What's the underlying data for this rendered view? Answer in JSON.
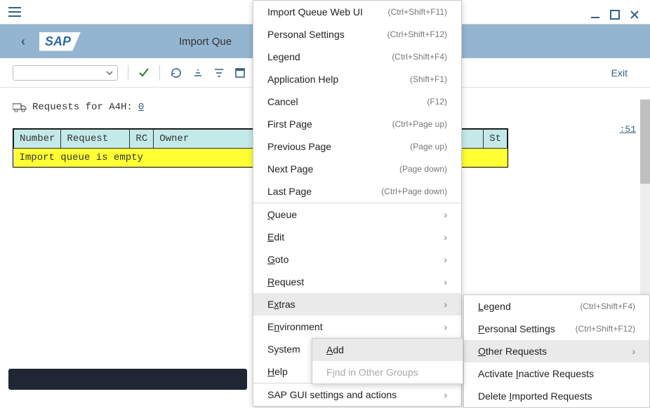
{
  "header": {
    "title": "Import Que",
    "logo_text": "SAP"
  },
  "toolbar": {
    "exit_label": "Exit"
  },
  "content": {
    "requests_label": "Requests for A4H:",
    "requests_count": "0",
    "empty_msg": "Import queue is empty",
    "time_stamp": ":51",
    "columns": {
      "number": "Number",
      "request": "Request",
      "rc": "RC",
      "owner": "Owner",
      "st": "St"
    }
  },
  "main_menu": {
    "items": [
      {
        "label": "Import Queue Web UI",
        "shortcut": "(Ctrl+Shift+F11)"
      },
      {
        "label": "Personal Settings",
        "shortcut": "(Ctrl+Shift+F12)"
      },
      {
        "label": "Legend",
        "shortcut": "(Ctrl+Shift+F4)"
      },
      {
        "label": "Application Help",
        "shortcut": "(Shift+F1)"
      },
      {
        "label": "Cancel",
        "shortcut": "(F12)"
      },
      {
        "label": "First Page",
        "shortcut": "(Ctrl+Page up)"
      },
      {
        "label": "Previous Page",
        "shortcut": "(Page up)"
      },
      {
        "label": "Next Page",
        "shortcut": "(Page down)"
      },
      {
        "label": "Last Page",
        "shortcut": "(Ctrl+Page down)"
      }
    ],
    "subs": [
      {
        "label": "Queue",
        "ul": "Q"
      },
      {
        "label": "Edit",
        "ul": "E"
      },
      {
        "label": "Goto",
        "ul": "G"
      },
      {
        "label": "Request",
        "ul": "R"
      },
      {
        "label": "Extras",
        "ul": "x"
      },
      {
        "label": "Environment",
        "ul": "n"
      },
      {
        "label": "System"
      },
      {
        "label": "Help",
        "ul": "H"
      },
      {
        "label": "SAP GUI settings and actions"
      }
    ]
  },
  "extras_menu": {
    "items": [
      {
        "label_pre": "",
        "ul": "L",
        "label_post": "egend",
        "shortcut": "(Ctrl+Shift+F4)"
      },
      {
        "label_pre": "",
        "ul": "P",
        "label_post": "ersonal Settings",
        "shortcut": "(Ctrl+Shift+F12)"
      },
      {
        "label_pre": "",
        "ul": "O",
        "label_post": "ther Requests",
        "shortcut": "",
        "chevron": true,
        "hover": true
      },
      {
        "label_pre": "Activate ",
        "ul": "I",
        "label_post": "nactive Requests"
      },
      {
        "label_pre": "Delete ",
        "ul": "I",
        "label_post": "mported Requests"
      }
    ]
  },
  "other_req_menu": {
    "add_pre": "",
    "add_ul": "A",
    "add_post": "dd",
    "find_pre": "F",
    "find_ul": "i",
    "find_post": "nd in Other Groups"
  }
}
